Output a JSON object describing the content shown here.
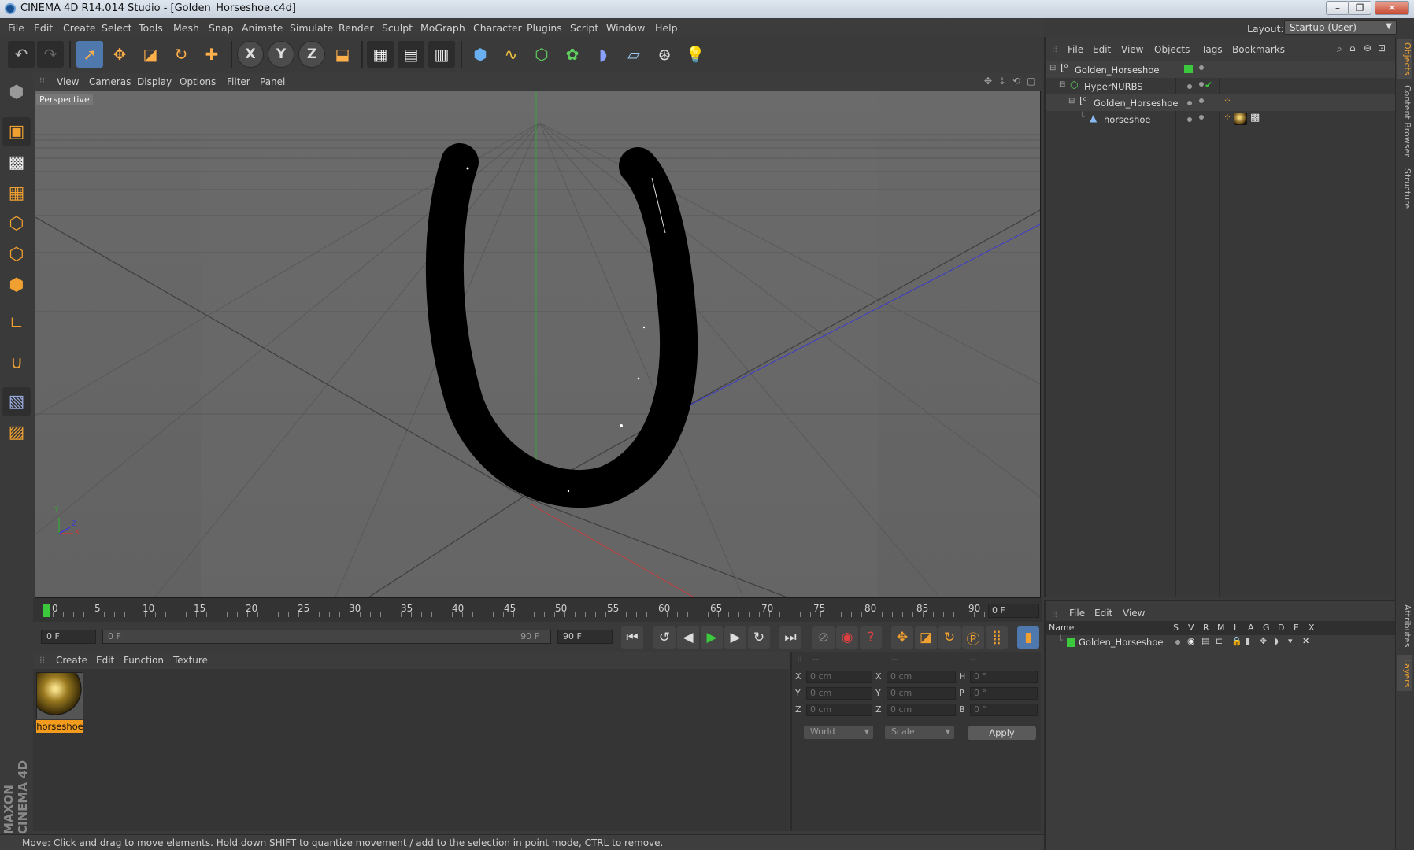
{
  "window": {
    "title": "CINEMA 4D R14.014 Studio - [Golden_Horseshoe.c4d]",
    "controls": [
      "–",
      "❐",
      "✕"
    ]
  },
  "menubar": {
    "items": [
      "File",
      "Edit",
      "Create",
      "Select",
      "Tools",
      "Mesh",
      "Snap",
      "Animate",
      "Simulate",
      "Render",
      "Sculpt",
      "MoGraph",
      "Character",
      "Plugins",
      "Script",
      "Window",
      "Help"
    ],
    "layout_label": "Layout:",
    "layout_value": "Startup (User)"
  },
  "toolbar": {
    "axis_x": "X",
    "axis_y": "Y",
    "axis_z": "Z"
  },
  "viewport": {
    "menu": [
      "View",
      "Cameras",
      "Display",
      "Options",
      "Filter",
      "Panel"
    ],
    "camera_label": "Perspective",
    "axis_labels": {
      "y": "Y",
      "x": "X",
      "z": "Z"
    }
  },
  "timeline": {
    "ticks": [
      "0",
      "5",
      "10",
      "15",
      "20",
      "25",
      "30",
      "35",
      "40",
      "45",
      "50",
      "55",
      "60",
      "65",
      "70",
      "75",
      "80",
      "85",
      "90"
    ],
    "current_frame": "0 F",
    "start_field": "0 F",
    "range_start": "0 F",
    "range_end": "90 F",
    "end_field": "90 F"
  },
  "material_manager": {
    "menu": [
      "Create",
      "Edit",
      "Function",
      "Texture"
    ],
    "materials": [
      {
        "name": "horseshoe"
      }
    ]
  },
  "coordinates": {
    "headers": [
      "--",
      "--",
      "--"
    ],
    "rows": [
      {
        "axis": "X",
        "pos": "0 cm",
        "axis2": "X",
        "size": "0 cm",
        "rot_label": "H",
        "rot": "0 °"
      },
      {
        "axis": "Y",
        "pos": "0 cm",
        "axis2": "Y",
        "size": "0 cm",
        "rot_label": "P",
        "rot": "0 °"
      },
      {
        "axis": "Z",
        "pos": "0 cm",
        "axis2": "Z",
        "size": "0 cm",
        "rot_label": "B",
        "rot": "0 °"
      }
    ],
    "space": "World",
    "mode": "Scale",
    "apply": "Apply"
  },
  "status": "Move: Click and drag to move elements. Hold down SHIFT to quantize movement / add to the selection in point mode, CTRL to remove.",
  "object_manager": {
    "menu": [
      "File",
      "Edit",
      "View",
      "Objects",
      "Tags",
      "Bookmarks"
    ],
    "objects": [
      {
        "name": "Golden_Horseshoe",
        "color": "#3cc83c"
      },
      {
        "name": "HyperNURBS",
        "color": "#9a9a9a"
      },
      {
        "name": "Golden_Horseshoe",
        "color": "#9a9a9a"
      },
      {
        "name": "horseshoe",
        "color": "#9a9a9a"
      }
    ]
  },
  "layer_manager": {
    "menu": [
      "File",
      "Edit",
      "View"
    ],
    "columns": [
      "Name",
      "S",
      "V",
      "R",
      "M",
      "L",
      "A",
      "G",
      "D",
      "E",
      "X"
    ],
    "layers": [
      {
        "name": "Golden_Horseshoe",
        "color": "#3cc83c"
      }
    ]
  },
  "right_tabs": [
    "Objects",
    "Content Browser",
    "Structure",
    "Attributes",
    "Layers"
  ],
  "brand": "MAXON CINEMA 4D"
}
